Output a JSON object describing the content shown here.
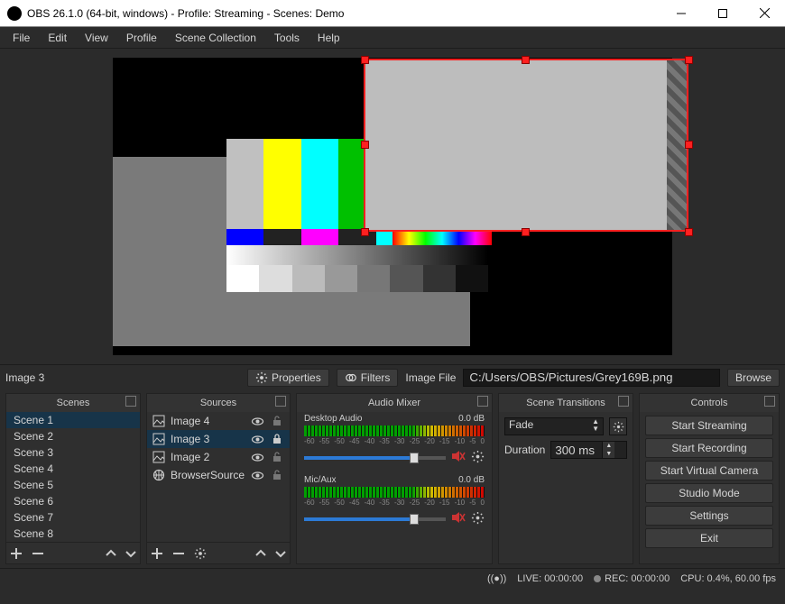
{
  "window": {
    "title": "OBS 26.1.0 (64-bit, windows) - Profile: Streaming - Scenes: Demo"
  },
  "menus": [
    "File",
    "Edit",
    "View",
    "Profile",
    "Scene Collection",
    "Tools",
    "Help"
  ],
  "context": {
    "selected_source": "Image 3",
    "properties_label": "Properties",
    "filters_label": "Filters",
    "file_label": "Image File",
    "file_value": "C:/Users/OBS/Pictures/Grey169B.png",
    "browse_label": "Browse"
  },
  "scenes": {
    "title": "Scenes",
    "items": [
      "Scene 1",
      "Scene 2",
      "Scene 3",
      "Scene 4",
      "Scene 5",
      "Scene 6",
      "Scene 7",
      "Scene 8"
    ],
    "selected": 0
  },
  "sources": {
    "title": "Sources",
    "items": [
      {
        "name": "Image 4",
        "icon": "image",
        "visible": true,
        "locked": false
      },
      {
        "name": "Image 3",
        "icon": "image",
        "visible": true,
        "locked": true
      },
      {
        "name": "Image 2",
        "icon": "image",
        "visible": true,
        "locked": false
      },
      {
        "name": "BrowserSource",
        "icon": "globe",
        "visible": true,
        "locked": false
      }
    ],
    "selected": 1
  },
  "mixer": {
    "title": "Audio Mixer",
    "channels": [
      {
        "name": "Desktop Audio",
        "level": "0.0 dB"
      },
      {
        "name": "Mic/Aux",
        "level": "0.0 dB"
      }
    ],
    "ticks": [
      "-60",
      "-55",
      "-50",
      "-45",
      "-40",
      "-35",
      "-30",
      "-25",
      "-20",
      "-15",
      "-10",
      "-5",
      "0"
    ]
  },
  "transitions": {
    "title": "Scene Transitions",
    "selected": "Fade",
    "duration_label": "Duration",
    "duration_value": "300 ms"
  },
  "controls": {
    "title": "Controls",
    "buttons": [
      "Start Streaming",
      "Start Recording",
      "Start Virtual Camera",
      "Studio Mode",
      "Settings",
      "Exit"
    ]
  },
  "status": {
    "live": "LIVE: 00:00:00",
    "rec": "REC: 00:00:00",
    "cpu": "CPU: 0.4%, 60.00 fps"
  }
}
